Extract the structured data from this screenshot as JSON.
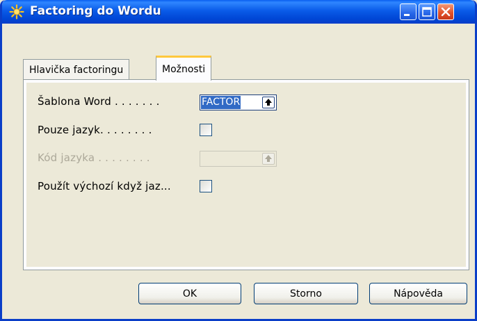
{
  "window": {
    "title": "Factoring do Wordu",
    "icon": "sun-icon"
  },
  "title_buttons": {
    "minimize_icon": "minimize-icon",
    "maximize_icon": "maximize-icon",
    "close_icon": "close-icon"
  },
  "tabs": [
    {
      "label": "Hlavička factoringu",
      "active": false
    },
    {
      "label": "Možnosti",
      "active": true
    }
  ],
  "fields": {
    "sablona_label": "Šablona Word . . . . . . .",
    "sablona_value": "FACTOR",
    "pouze_label": "Pouze jazyk. . . . . . . .",
    "pouze_checked": false,
    "kod_label": "Kód jazyka . . . . . . . .",
    "kod_value": "",
    "kod_disabled": true,
    "pouzit_label": "Použít výchozí když jaz...",
    "pouzit_checked": false
  },
  "buttons": {
    "ok": "OK",
    "storno": "Storno",
    "help": "Nápověda"
  },
  "colors": {
    "titlebar": "#0A5BE8",
    "active_tab_accent": "#FFC83C",
    "selection": "#316AC5",
    "dialog_bg": "#ECE9D8"
  }
}
